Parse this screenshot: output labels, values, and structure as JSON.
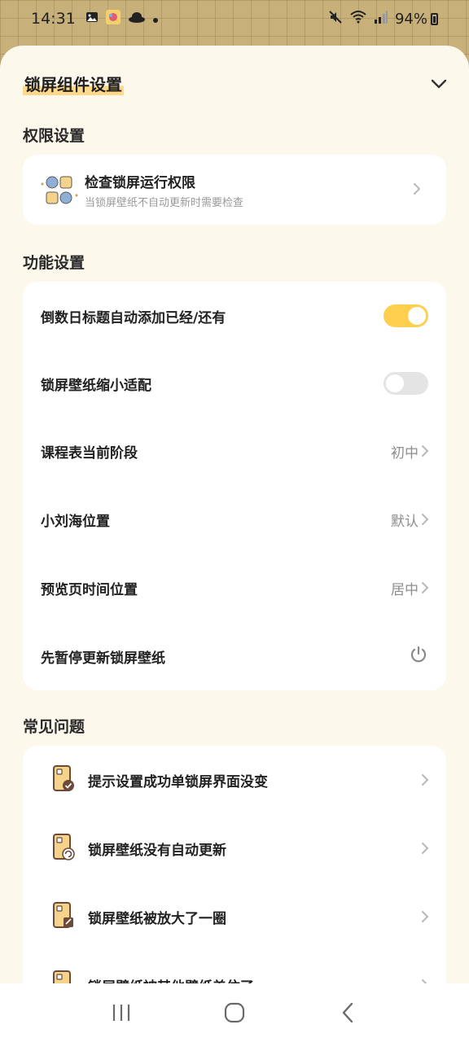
{
  "status_bar": {
    "time": "14:31",
    "battery": "94%",
    "icons": [
      "image-icon",
      "app-icon",
      "hat-icon",
      "dot-icon",
      "mute-icon",
      "wifi-icon",
      "signal-icon",
      "battery-icon"
    ]
  },
  "sheet": {
    "title": "锁屏组件设置"
  },
  "permissions": {
    "section_label": "权限设置",
    "item": {
      "title": "检查锁屏运行权限",
      "subtitle": "当锁屏壁纸不自动更新时需要检查"
    }
  },
  "features": {
    "section_label": "功能设置",
    "items": [
      {
        "label": "倒数日标题自动添加已经/还有",
        "control": "toggle",
        "on": true
      },
      {
        "label": "锁屏壁纸缩小适配",
        "control": "toggle",
        "on": false
      },
      {
        "label": "课程表当前阶段",
        "control": "value",
        "value": "初中"
      },
      {
        "label": "小刘海位置",
        "control": "value",
        "value": "默认"
      },
      {
        "label": "预览页时间位置",
        "control": "value",
        "value": "居中"
      },
      {
        "label": "先暂停更新锁屏壁纸",
        "control": "power"
      }
    ]
  },
  "faq": {
    "section_label": "常见问题",
    "items": [
      {
        "label": "提示设置成功单锁屏界面没变"
      },
      {
        "label": "锁屏壁纸没有自动更新"
      },
      {
        "label": "锁屏壁纸被放大了一圈"
      },
      {
        "label": "锁屏壁纸被其他壁纸盖住了"
      }
    ]
  },
  "colors": {
    "accent": "#ffcf4d",
    "sheet_bg": "#fdf8ec",
    "card_bg": "#ffffff",
    "title_highlight": "#ffd88a"
  }
}
